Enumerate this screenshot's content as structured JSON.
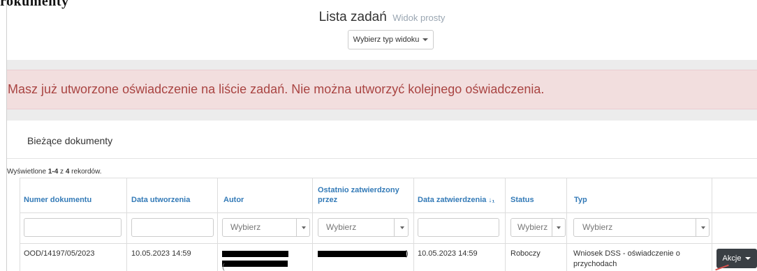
{
  "top_fragment": "rokumenty",
  "header": {
    "title": "Lista zadań",
    "subtitle": "Widok prosty",
    "view_button_label": "Wybierz typ widoku"
  },
  "alert": {
    "message": "Masz już utworzone oświadczenie na liście zadań. Nie można utworzyć kolejnego oświadczenia."
  },
  "panel": {
    "title": "Bieżące dokumenty"
  },
  "summary": {
    "prefix": "Wyświetlone ",
    "range": "1-4",
    "middle": " z ",
    "total": "4",
    "suffix": " rekordów."
  },
  "table": {
    "columns": [
      {
        "label": "Numer dokumentu"
      },
      {
        "label": "Data utworzenia"
      },
      {
        "label": "Autor"
      },
      {
        "label": "Ostatnio zatwierdzony przez"
      },
      {
        "label": "Data zatwierdzenia"
      },
      {
        "label": "Status"
      },
      {
        "label": "Typ"
      }
    ],
    "filters": {
      "autor_placeholder": "Wybierz",
      "approver_placeholder": "Wybierz",
      "status_placeholder": "Wybierz",
      "typ_placeholder": "Wybierz"
    },
    "rows": [
      {
        "numer": "OOD/14197/05/2023",
        "data_utworzenia": "10.05.2023 14:59",
        "autor_suffix": "(",
        "approver_suffix": ")",
        "data_zatwierdzenia": "10.05.2023 14:59",
        "status": "Roboczy",
        "typ_line1": "Wniosek DSS - oświadczenie o",
        "typ_line2": "przychodach",
        "actions_label": "Akcje"
      }
    ]
  },
  "colors": {
    "link_blue": "#337ab7",
    "alert_bg": "#f2dede",
    "alert_text": "#a94442",
    "band_gray": "#ececec",
    "actions_bg": "#3a3f44"
  }
}
